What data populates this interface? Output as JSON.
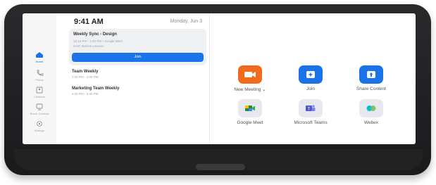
{
  "status": {
    "time": "9:41 AM",
    "date": "Monday, Jun 3"
  },
  "sidebar": {
    "items": [
      {
        "label": "Home",
        "icon": "home-icon",
        "active": true
      },
      {
        "label": "Phone",
        "icon": "phone-icon",
        "active": false
      },
      {
        "label": "Contacts",
        "icon": "contacts-icon",
        "active": false
      },
      {
        "label": "Room Controls",
        "icon": "room-controls-icon",
        "active": false
      },
      {
        "label": "Settings",
        "icon": "settings-icon",
        "active": false
      }
    ]
  },
  "agenda": {
    "current": {
      "title": "Weekly Sync - Design",
      "subtitle": "12:15 PM - 1:00 PM • Google Meet",
      "host": "Host: Maxine Lawson",
      "join_label": "Join"
    },
    "upcoming": [
      {
        "title": "Team Weekly",
        "time": "2:00 PM - 3:00 PM"
      },
      {
        "title": "Marketing Team Weekly",
        "time": "4:00 PM - 5:00 PM"
      }
    ]
  },
  "actions": [
    {
      "label": "New Meeting ⌄",
      "icon": "video-camera-icon",
      "color": "#f26b1d"
    },
    {
      "label": "Join",
      "icon": "plus-icon",
      "color": "#1a73e8"
    },
    {
      "label": "Share Content",
      "icon": "share-upload-icon",
      "color": "#1a73e8"
    }
  ],
  "integrations": [
    {
      "label": "Google Meet",
      "icon": "google-meet-icon",
      "color": "#e7e9ee"
    },
    {
      "label": "Microsoft Teams",
      "icon": "microsoft-teams-icon",
      "color": "#e7e9ee"
    },
    {
      "label": "Webex",
      "icon": "webex-icon",
      "color": "#e7e9ee"
    }
  ]
}
